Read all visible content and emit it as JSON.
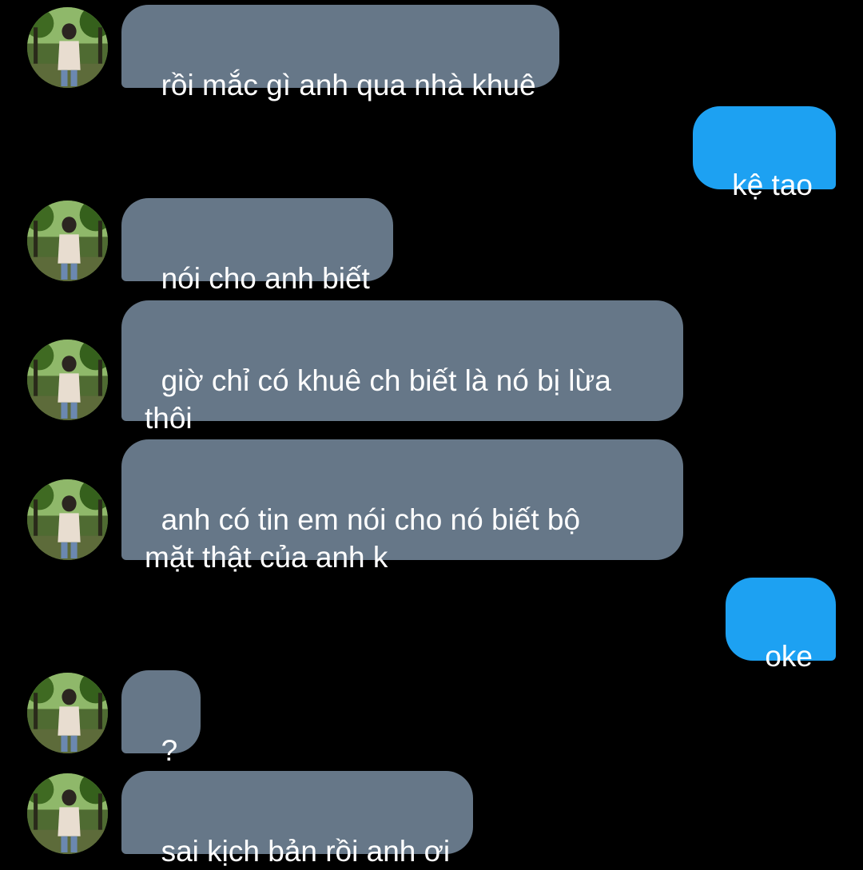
{
  "colors": {
    "background": "#000000",
    "incoming_bubble": "#667788",
    "outgoing_bubble": "#1da1f2",
    "text": "#ffffff"
  },
  "messages": [
    {
      "direction": "in",
      "text": "rồi mắc gì anh qua nhà khuê"
    },
    {
      "direction": "out",
      "text": "kệ tao"
    },
    {
      "direction": "in",
      "text": "nói cho anh biết"
    },
    {
      "direction": "in",
      "text": "giờ chỉ có khuê ch biết là nó bị lừa\nthôi"
    },
    {
      "direction": "in",
      "text": "anh có tin em nói cho nó biết bộ\nmặt thật của anh k"
    },
    {
      "direction": "out",
      "text": "oke"
    },
    {
      "direction": "in",
      "text": "?"
    },
    {
      "direction": "in",
      "text": "sai kịch bản rồi anh ơi"
    }
  ],
  "avatar_icon": "profile-photo-icon"
}
